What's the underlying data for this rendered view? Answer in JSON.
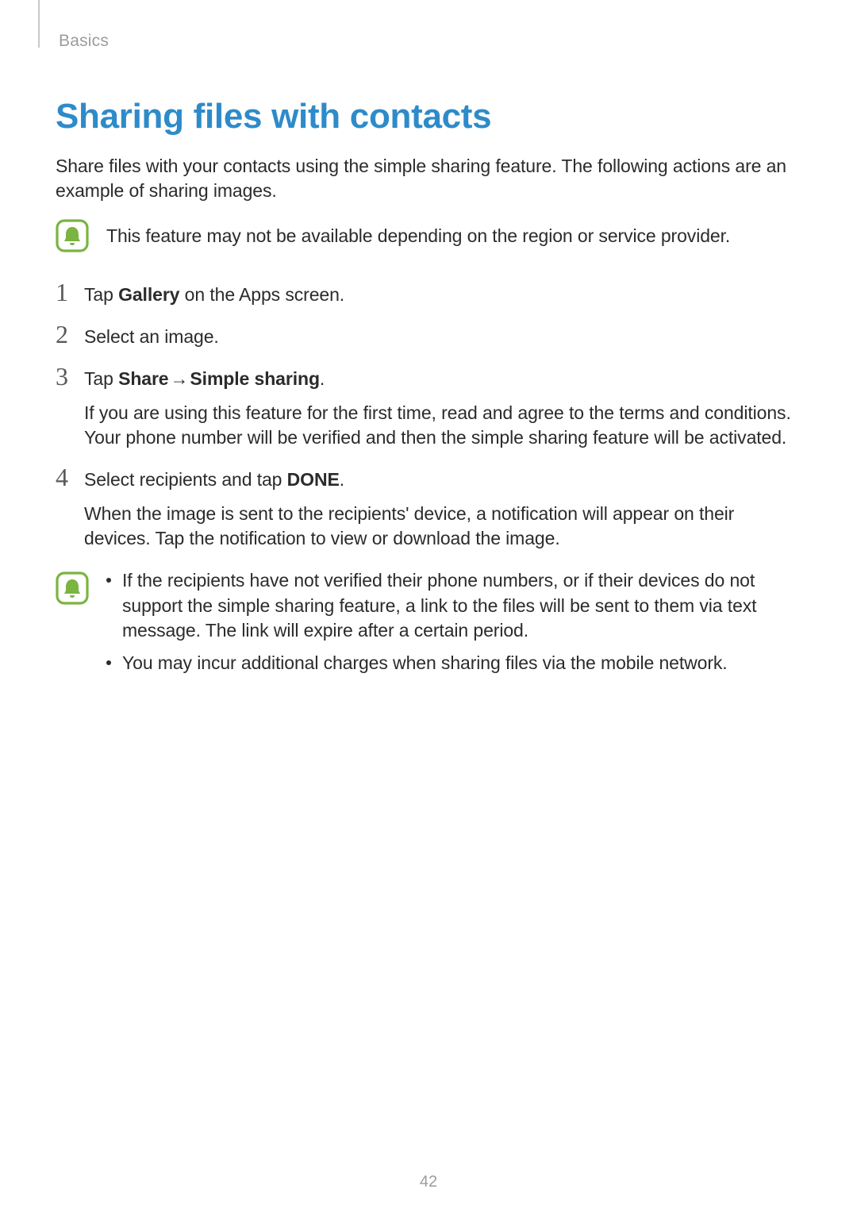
{
  "breadcrumb": "Basics",
  "title": "Sharing files with contacts",
  "intro": "Share files with your contacts using the simple sharing feature. The following actions are an example of sharing images.",
  "note1": "This feature may not be available depending on the region or service provider.",
  "steps": {
    "s1": {
      "num": "1",
      "prefix": "Tap ",
      "bold": "Gallery",
      "suffix": " on the Apps screen."
    },
    "s2": {
      "num": "2",
      "text": "Select an image."
    },
    "s3": {
      "num": "3",
      "prefix": "Tap ",
      "bold1": "Share",
      "arrow": " → ",
      "bold2": "Simple sharing",
      "suffix": ".",
      "detail": "If you are using this feature for the first time, read and agree to the terms and conditions. Your phone number will be verified and then the simple sharing feature will be activated."
    },
    "s4": {
      "num": "4",
      "prefix": "Select recipients and tap ",
      "bold": "DONE",
      "suffix": ".",
      "detail": "When the image is sent to the recipients' device, a notification will appear on their devices. Tap the notification to view or download the image."
    }
  },
  "note2": {
    "b1": "If the recipients have not verified their phone numbers, or if their devices do not support the simple sharing feature, a link to the files will be sent to them via text message. The link will expire after a certain period.",
    "b2": "You may incur additional charges when sharing files via the mobile network."
  },
  "page_number": "42"
}
